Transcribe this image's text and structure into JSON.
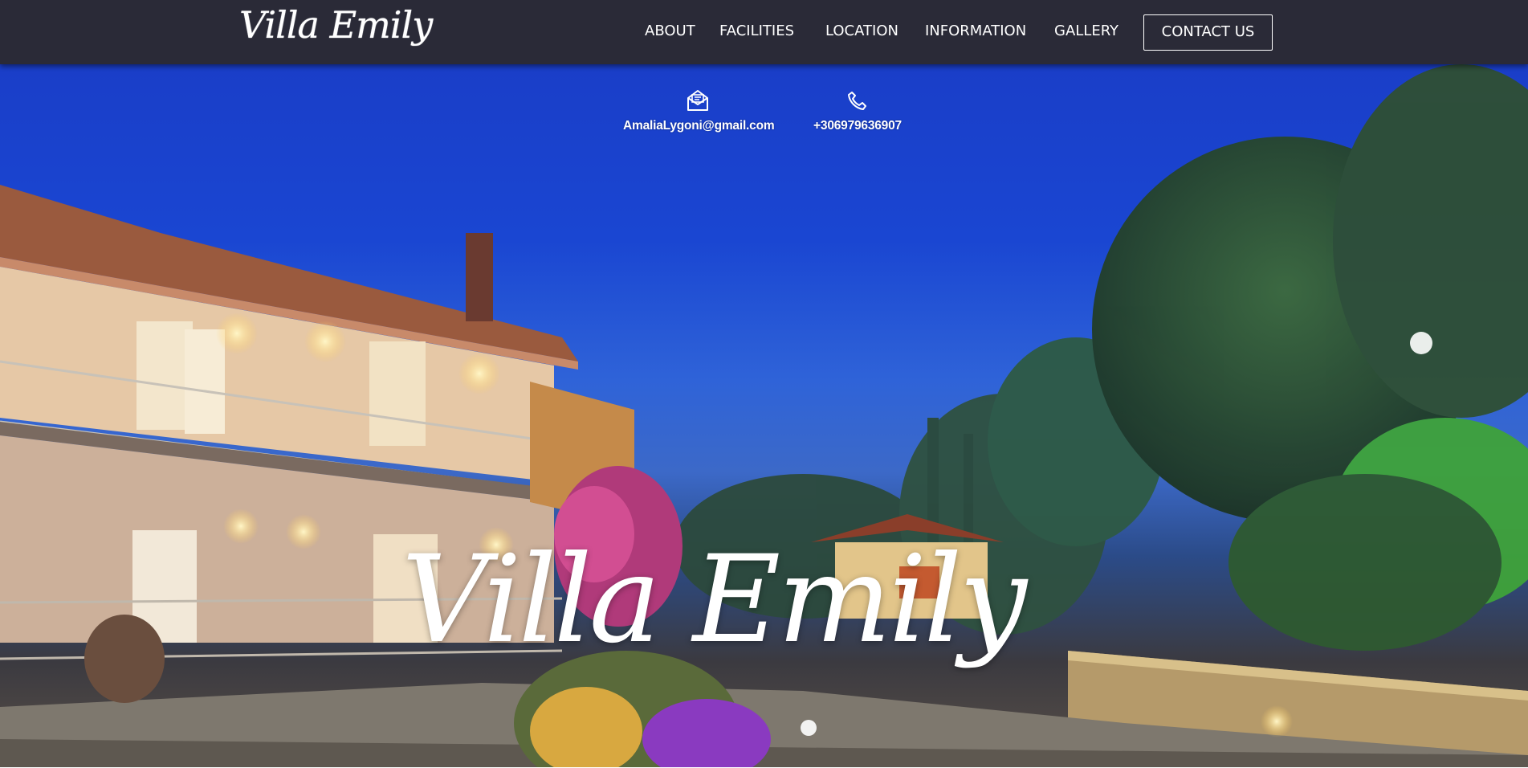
{
  "brand": {
    "logo_text": "Villa Emily"
  },
  "nav": {
    "items": [
      {
        "label": "ABOUT"
      },
      {
        "label": "FACILITIES"
      },
      {
        "label": "LOCATION"
      },
      {
        "label": "INFORMATION"
      },
      {
        "label": "GALLERY"
      }
    ],
    "contact_button": "CONTACT US"
  },
  "hero": {
    "email": {
      "icon": "envelope-icon",
      "text": "AmaliaLygoni@gmail.com"
    },
    "phone": {
      "icon": "phone-icon",
      "text": "+306979636907"
    },
    "title": "Villa Emily",
    "background": "night-view-villa-photo"
  },
  "colors": {
    "navbar_bg": "#2a2a37",
    "text": "#ffffff",
    "sky": "#1a46d2"
  }
}
